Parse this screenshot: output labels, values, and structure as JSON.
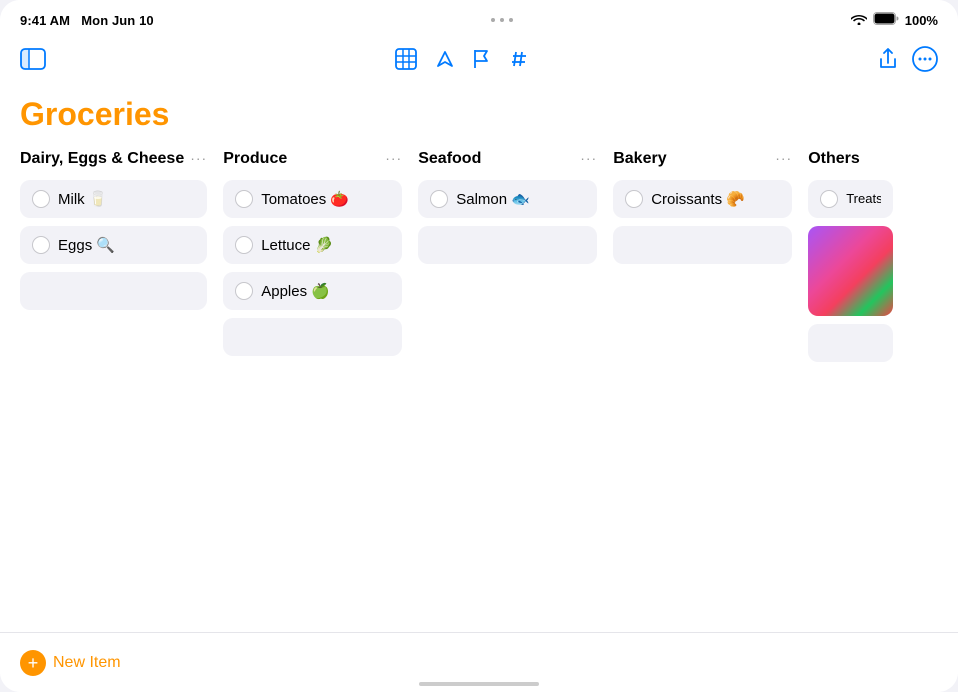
{
  "status_bar": {
    "time": "9:41 AM",
    "date": "Mon Jun 10",
    "battery": "100%"
  },
  "toolbar": {
    "center_icons": [
      "table-icon",
      "arrow-up-icon",
      "flag-icon",
      "hash-icon"
    ],
    "right_icons": [
      "share-icon",
      "more-icon"
    ]
  },
  "page": {
    "title": "Groceries"
  },
  "columns": [
    {
      "id": "dairy",
      "title": "Dairy, Eggs & Cheese",
      "items": [
        {
          "label": "Milk 🥛",
          "checked": false
        },
        {
          "label": "Eggs 🔍",
          "checked": false
        }
      ],
      "has_empty": true
    },
    {
      "id": "produce",
      "title": "Produce",
      "items": [
        {
          "label": "Tomatoes 🍅",
          "checked": false
        },
        {
          "label": "Lettuce 🥬",
          "checked": false
        },
        {
          "label": "Apples 🍏",
          "checked": false
        }
      ],
      "has_empty": true
    },
    {
      "id": "seafood",
      "title": "Seafood",
      "items": [
        {
          "label": "Salmon 🐟",
          "checked": false
        }
      ],
      "has_empty": true
    },
    {
      "id": "bakery",
      "title": "Bakery",
      "items": [
        {
          "label": "Croissants 🥐",
          "checked": false
        }
      ],
      "has_empty": true
    },
    {
      "id": "others",
      "title": "Others",
      "items": [
        {
          "label": "Treats for",
          "checked": false
        }
      ],
      "has_image": true,
      "has_empty": true
    }
  ],
  "new_item": {
    "label": "New Item"
  }
}
